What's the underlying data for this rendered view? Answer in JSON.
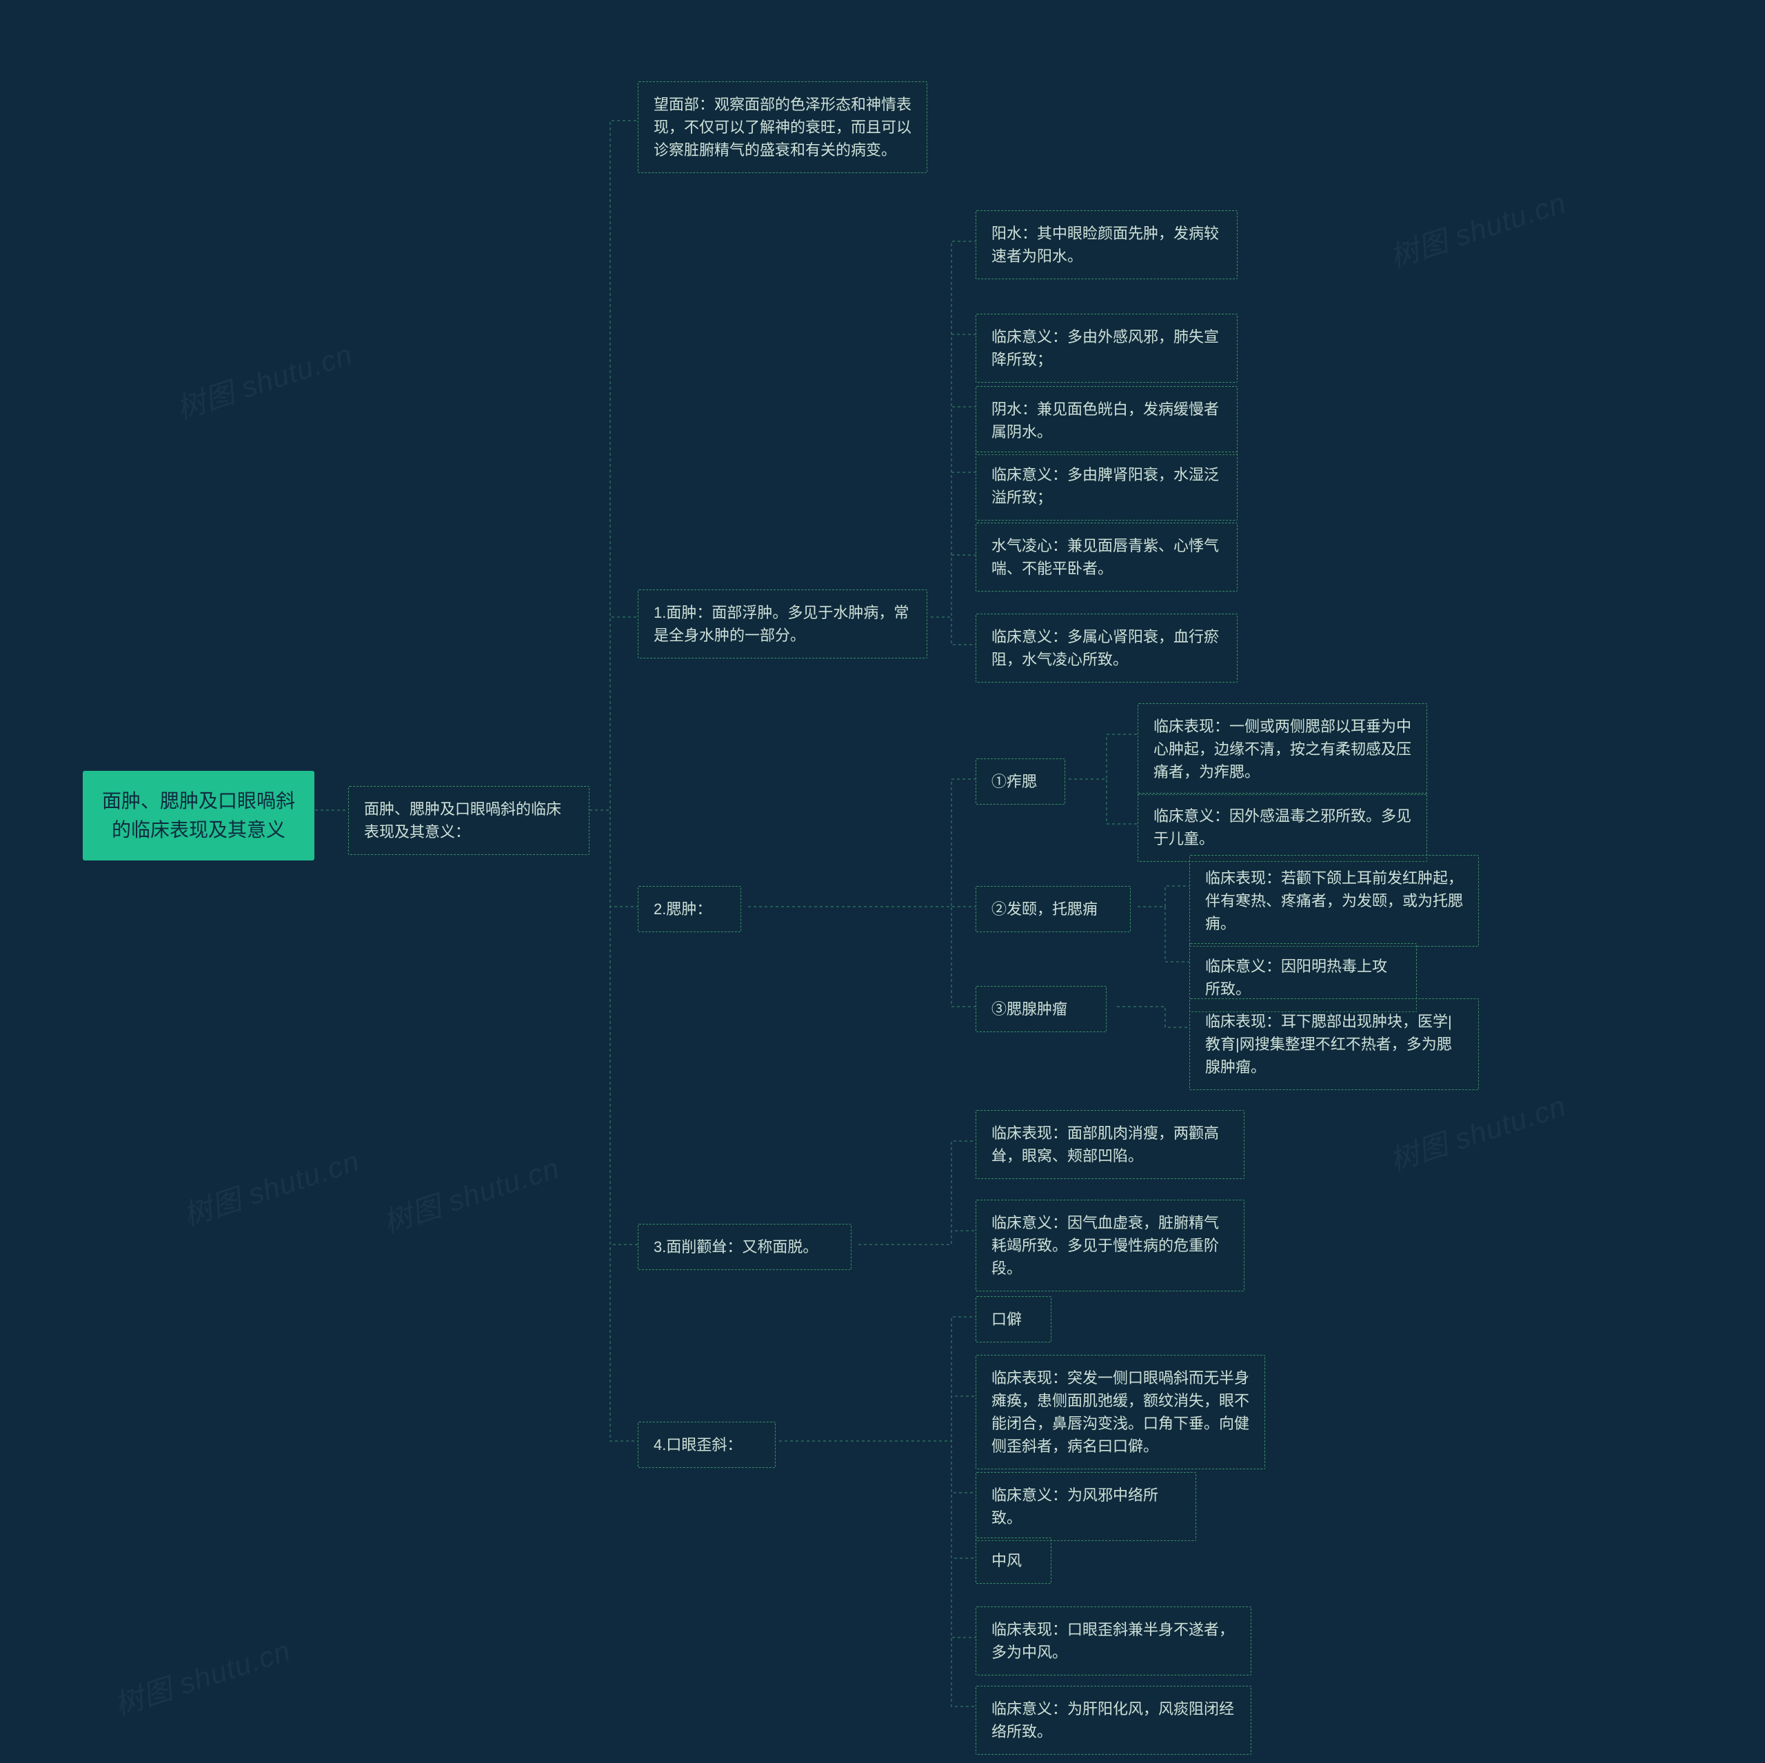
{
  "root": {
    "text": "面肿、腮肿及口眼喎斜的临床表现及其意义"
  },
  "c1": {
    "text": "面肿、腮肿及口眼喎斜的临床表现及其意义："
  },
  "c1a": {
    "text": "望面部：观察面部的色泽形态和神情表现，不仅可以了解神的衰旺，而且可以诊察脏腑精气的盛衰和有关的病变。"
  },
  "c1b": {
    "text": "1.面肿：面部浮肿。多见于水肿病，常是全身水肿的一部分。"
  },
  "c1b1": {
    "text": "阳水：其中眼睑颜面先肿，发病较速者为阳水。"
  },
  "c1b2": {
    "text": "临床意义：多由外感风邪，肺失宣降所致；"
  },
  "c1b3": {
    "text": "阴水：兼见面色㿠白，发病缓慢者属阴水。"
  },
  "c1b4": {
    "text": "临床意义：多由脾肾阳衰，水湿泛溢所致；"
  },
  "c1b5": {
    "text": "水气凌心：兼见面唇青紫、心悸气喘、不能平卧者。"
  },
  "c1b6": {
    "text": "临床意义：多属心肾阳衰，血行瘀阻，水气凌心所致。"
  },
  "c1c": {
    "text": "2.腮肿："
  },
  "c1c1": {
    "text": "①痄腮"
  },
  "c1c1a": {
    "text": "临床表现：一侧或两侧腮部以耳垂为中心肿起，边缘不清，按之有柔韧感及压痛者，为痄腮。"
  },
  "c1c1b": {
    "text": "临床意义：因外感温毒之邪所致。多见于儿童。"
  },
  "c1c2": {
    "text": "②发颐，托腮痈"
  },
  "c1c2a": {
    "text": "临床表现：若颧下颌上耳前发红肿起，伴有寒热、疼痛者，为发颐，或为托腮痈。"
  },
  "c1c2b": {
    "text": "临床意义：因阳明热毒上攻所致。"
  },
  "c1c3": {
    "text": "③腮腺肿瘤"
  },
  "c1c3a": {
    "text": "临床表现：耳下腮部出现肿块，医学|教育|网搜集整理不红不热者，多为腮腺肿瘤。"
  },
  "c1d": {
    "text": "3.面削颧耸：又称面脱。"
  },
  "c1d1": {
    "text": "临床表现：面部肌肉消瘦，两颧高耸，眼窝、颊部凹陷。"
  },
  "c1d2": {
    "text": "临床意义：因气血虚衰，脏腑精气耗竭所致。多见于慢性病的危重阶段。"
  },
  "c1e": {
    "text": "4.口眼歪斜："
  },
  "c1e1": {
    "text": "口僻"
  },
  "c1e2": {
    "text": "临床表现：突发一侧口眼喎斜而无半身瘫痪，患侧面肌弛缓，额纹消失，眼不能闭合，鼻唇沟变浅。口角下垂。向健侧歪斜者，病名曰口僻。"
  },
  "c1e3": {
    "text": "临床意义：为风邪中络所致。"
  },
  "c1e4": {
    "text": "中风"
  },
  "c1e5": {
    "text": "临床表现：口眼歪斜兼半身不遂者，多为中风。"
  },
  "c1e6": {
    "text": "临床意义：为肝阳化风，风痰阻闭经络所致。"
  },
  "watermark": "树图 shutu.cn"
}
